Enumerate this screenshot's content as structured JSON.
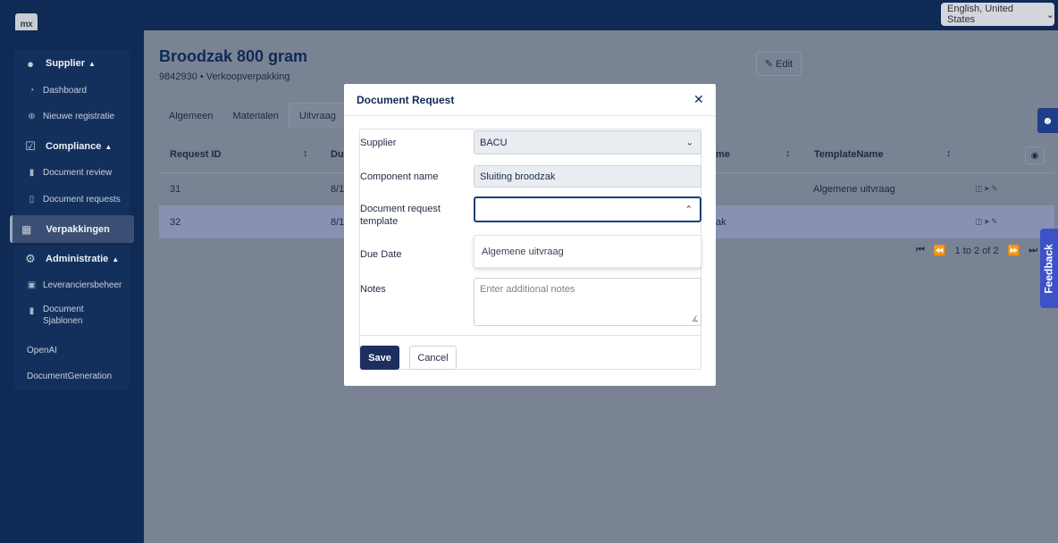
{
  "app": {
    "logo": "mx",
    "language": "English, United States"
  },
  "sidebar": {
    "groups": [
      {
        "label": "Supplier",
        "icon": "user-icon",
        "items": [
          "Dashboard",
          "Nieuwe registratie"
        ]
      },
      {
        "label": "Compliance",
        "icon": "checkbox-icon",
        "items": [
          "Document review",
          "Document requests"
        ]
      },
      {
        "label": "Verpakkingen",
        "icon": "boxes-icon",
        "items": []
      },
      {
        "label": "Administratie",
        "icon": "gear-icon",
        "items": [
          "Leveranciersbeheer",
          "Document Sjablonen",
          "OpenAI",
          "DocumentGeneration"
        ]
      }
    ]
  },
  "page": {
    "title": "Broodzak 800 gram",
    "subtitle": "9842930 • Verkoopverpakking",
    "edit_label": "Edit",
    "tabs": [
      "Algemeen",
      "Materialen",
      "Uitvraag"
    ],
    "active_tab": "Uitvraag",
    "table": {
      "headers": [
        "Request ID",
        "Du",
        "me",
        "TemplateName"
      ],
      "rows": [
        {
          "id": "31",
          "due": "8/1",
          "component": "",
          "template": "Algemene uitvraag"
        },
        {
          "id": "32",
          "due": "8/1",
          "component": "ak",
          "template": ""
        }
      ]
    },
    "pagination": "1 to 2 of 2",
    "feedback_label": "Feedback"
  },
  "modal": {
    "title": "Document Request",
    "fields": {
      "supplier_label": "Supplier",
      "supplier_value": "BACU",
      "component_label": "Component name",
      "component_value": "Sluiting broodzak",
      "template_label": "Document request template",
      "template_value": "",
      "template_options": [
        "Algemene uitvraag"
      ],
      "due_label": "Due Date",
      "notes_label": "Notes",
      "notes_placeholder": "Enter additional notes"
    },
    "save_label": "Save",
    "cancel_label": "Cancel"
  },
  "colors": {
    "navy": "#0f2a55",
    "primary_button": "#1c2f5f",
    "feedback": "#3d52c8"
  }
}
